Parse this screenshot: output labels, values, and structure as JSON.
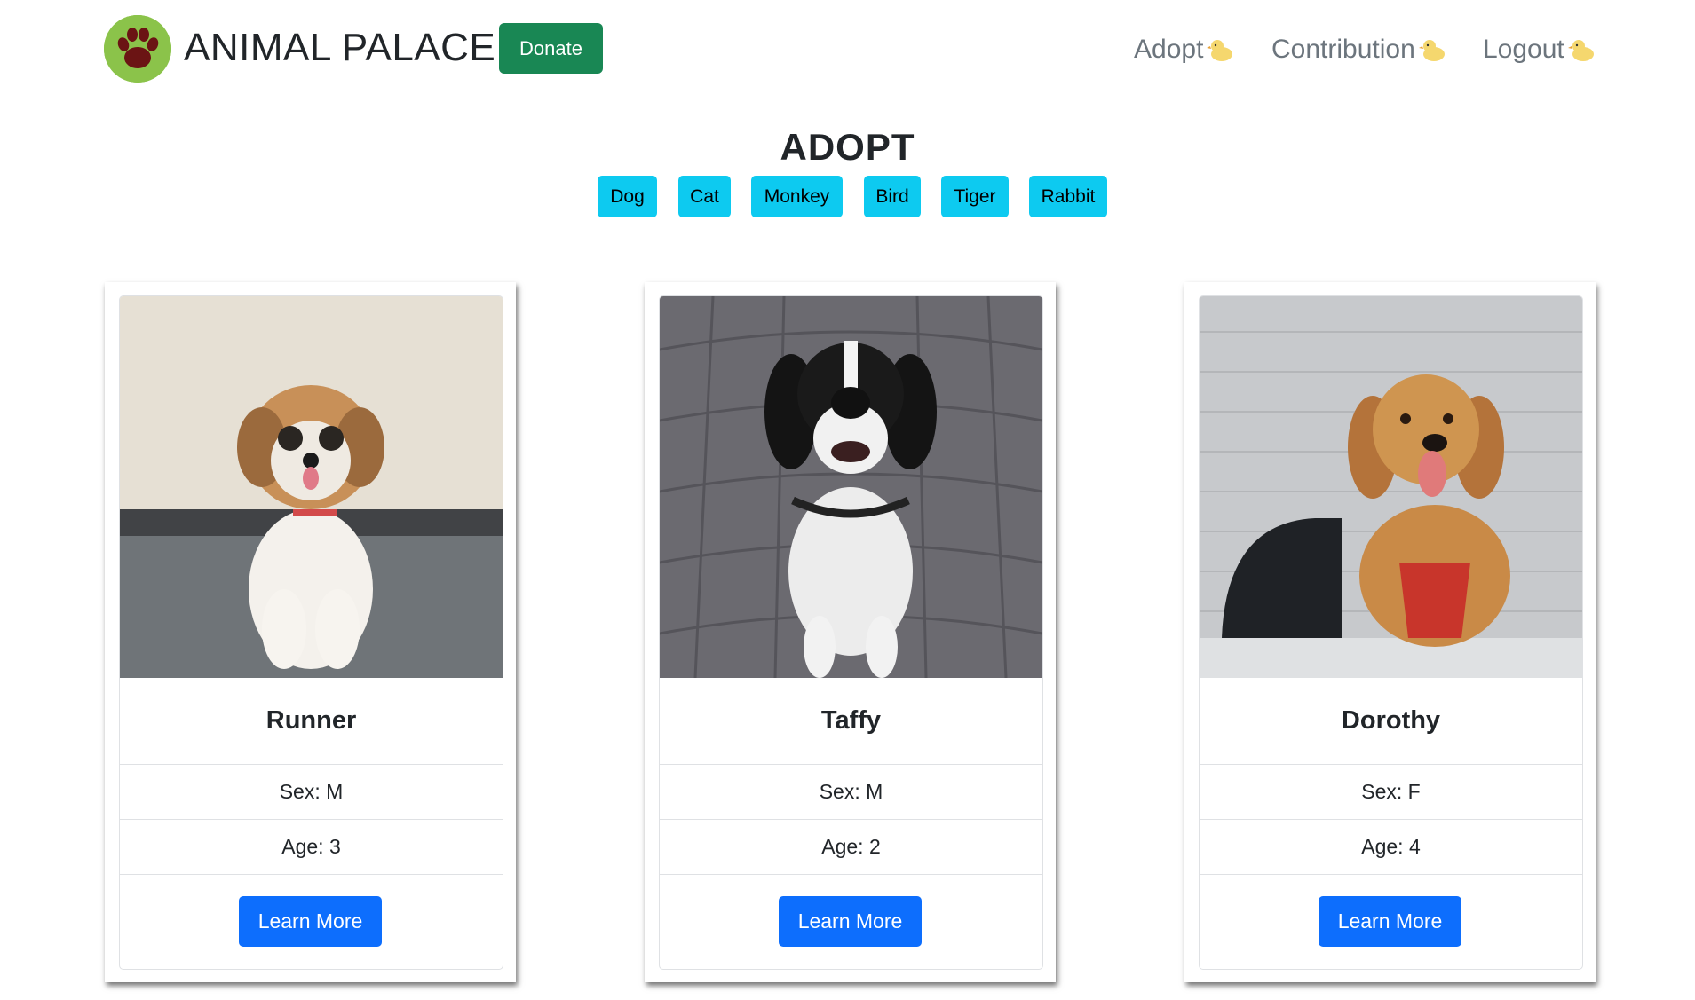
{
  "brand": {
    "name": "ANIMAL PALACE",
    "logo_icon": "paw-icon",
    "logo_color": "#8bc34a"
  },
  "header": {
    "donate_label": "Donate",
    "nav": [
      {
        "label": "Adopt",
        "icon": "chick-icon"
      },
      {
        "label": "Contribution",
        "icon": "chick-icon"
      },
      {
        "label": "Logout",
        "icon": "chick-icon"
      }
    ]
  },
  "page": {
    "title": "ADOPT",
    "filters": [
      "Dog",
      "Cat",
      "Monkey",
      "Bird",
      "Tiger",
      "Rabbit"
    ]
  },
  "cards": [
    {
      "name": "Runner",
      "sex": "Sex: M",
      "age": "Age: 3",
      "button": "Learn More",
      "photo": "shih-tzu-puppy-photo"
    },
    {
      "name": "Taffy",
      "sex": "Sex: M",
      "age": "Age: 2",
      "button": "Learn More",
      "photo": "black-white-pointer-dog-photo"
    },
    {
      "name": "Dorothy",
      "sex": "Sex: F",
      "age": "Age: 4",
      "button": "Learn More",
      "photo": "golden-retriever-photo"
    }
  ],
  "colors": {
    "donate": "#198754",
    "filter": "#0dcaf0",
    "primary": "#0d6efd",
    "nav_text": "#6c757d"
  }
}
